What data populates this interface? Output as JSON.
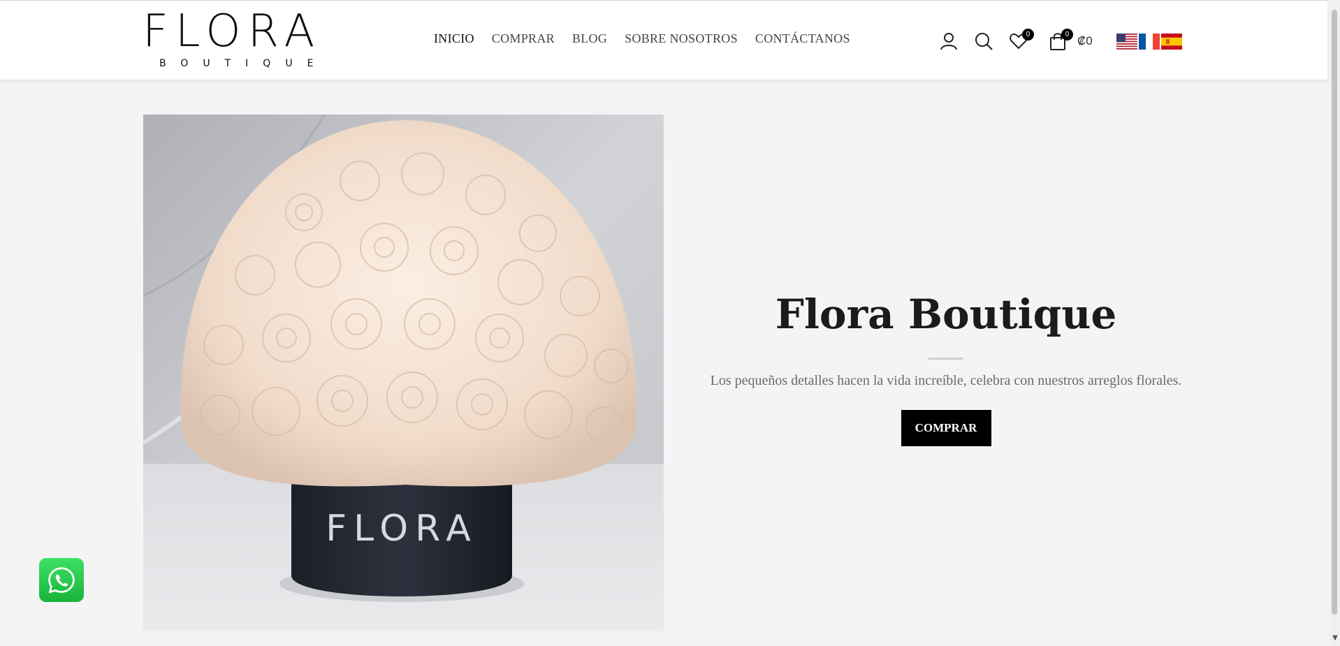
{
  "header": {
    "logo_main": "FLORA",
    "logo_sub": "BOUTIQUE",
    "nav": [
      "INICIO",
      "COMPRAR",
      "BLOG",
      "SOBRE NOSOTROS",
      "CONTÁCTANOS"
    ],
    "wishlist_count": "0",
    "cart_count": "0",
    "cart_total": "₡0",
    "languages": [
      "English (US)",
      "Français",
      "Español"
    ]
  },
  "hero": {
    "image_box_text": "FLORA",
    "title": "Flora Boutique",
    "subtitle": "Los pequeños detalles hacen la vida increíble, celebra con nuestros arreglos florales.",
    "button_label": "COMPRAR"
  },
  "icons": {
    "account": "user-icon",
    "search": "search-icon",
    "wishlist": "heart-icon",
    "cart": "shopping-bag-icon",
    "chat": "whatsapp-icon"
  },
  "colors": {
    "page_bg": "#f4f4f4",
    "header_bg": "#ffffff",
    "button_bg": "#000000",
    "whatsapp_green": "#25d366"
  }
}
